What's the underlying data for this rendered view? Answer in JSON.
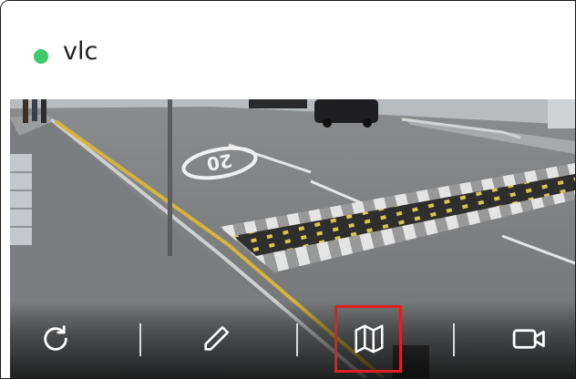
{
  "camera": {
    "name": "vlc",
    "status_color": "#3ec96a",
    "road_marking": "20"
  },
  "toolbar": {
    "buttons": [
      {
        "id": "refresh",
        "icon": "refresh-icon"
      },
      {
        "id": "edit",
        "icon": "pencil-icon"
      },
      {
        "id": "map",
        "icon": "map-icon",
        "highlighted": true
      },
      {
        "id": "video",
        "icon": "video-camera-icon"
      }
    ],
    "highlight_color": "#e02020"
  }
}
